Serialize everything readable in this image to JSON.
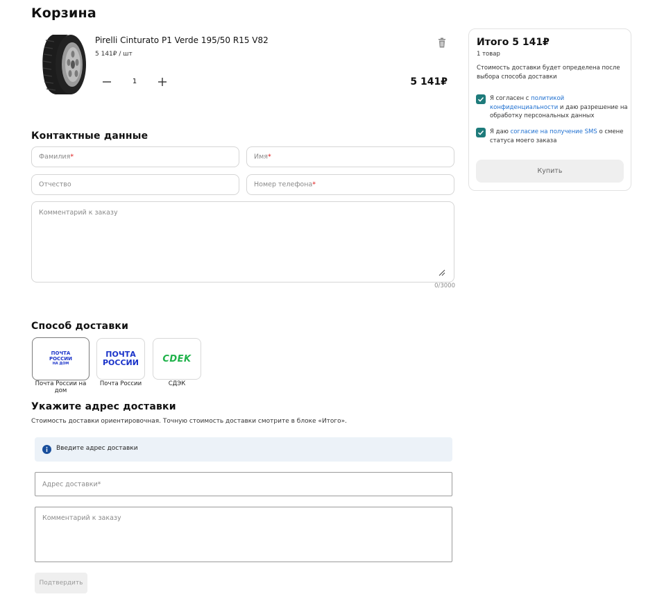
{
  "page": {
    "title": "Корзина"
  },
  "cart": {
    "item": {
      "name": "Pirelli Cinturato P1 Verde 195/50 R15 V82",
      "unit_price": "5 141₽ / шт",
      "quantity": "1",
      "total": "5 141₽"
    }
  },
  "contact": {
    "title": "Контактные данные",
    "last_name": "Фамилия",
    "first_name": "Имя",
    "patronymic": "Отчество",
    "phone": "Номер телефона",
    "required_mark": "*",
    "comment_placeholder": "Комментарий к заказу",
    "counter": "0/3000"
  },
  "delivery": {
    "title": "Способ доставки",
    "options": [
      {
        "label": "Почта России на дом",
        "logo_line1": "ПОЧТА",
        "logo_line2": "РОССИИ",
        "logo_line3": "НА ДОМ",
        "selected": true
      },
      {
        "label": "Почта России",
        "logo_line1": "ПОЧТА",
        "logo_line2": "РОССИИ",
        "selected": false
      },
      {
        "label": "СДЭК",
        "logo": "CDEK",
        "selected": false
      }
    ],
    "brand_colors": {
      "pochta": "#1a33c9",
      "cdek": "#1fb24a"
    }
  },
  "address": {
    "title": "Укажите адрес доставки",
    "hint": "Стоимость доставки ориентировочная. Точную стоимость доставки смотрите в блоке «Итого».",
    "info": "Введите адрес доставки",
    "address_placeholder": "Адрес доставки*",
    "comment_placeholder": "Комментарий к заказу",
    "confirm_label": "Подтвердить"
  },
  "summary": {
    "title": "Итого 5 141₽",
    "count": "1 товар",
    "note": "Стоимость доставки будет определена после выбора способа доставки",
    "consent1_pre": "Я согласен с ",
    "consent1_link": "политикой конфиденциальности",
    "consent1_post": " и даю разрешение на обработку персональных данных",
    "consent2_pre": "Я даю ",
    "consent2_link": "согласие на получение SMS",
    "consent2_post": " о смене статуса моего заказа",
    "buy_label": "Купить"
  },
  "colors": {
    "accent": "#1e7b7b",
    "link": "#1e6fd0",
    "info_bg": "#ecf2f8"
  }
}
